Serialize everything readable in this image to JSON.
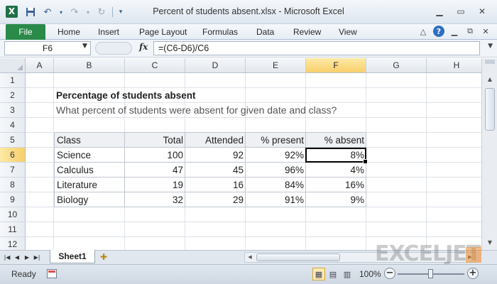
{
  "window": {
    "title": "Percent of students absent.xlsx  -  Microsoft Excel"
  },
  "quick_access": {
    "icons": [
      "excel-logo",
      "save-icon",
      "undo-icon",
      "redo-icon",
      "customize-icon"
    ]
  },
  "ribbon": {
    "file_label": "File",
    "tabs": [
      "Home",
      "Insert",
      "Page Layout",
      "Formulas",
      "Data",
      "Review",
      "View"
    ]
  },
  "formula_bar": {
    "name_box": "F6",
    "fx_label": "fx",
    "formula": "=(C6-D6)/C6"
  },
  "grid": {
    "columns": [
      "A",
      "B",
      "C",
      "D",
      "E",
      "F",
      "G",
      "H"
    ],
    "active_column": "F",
    "rows": [
      "1",
      "2",
      "3",
      "4",
      "5",
      "6",
      "7",
      "8",
      "9",
      "10",
      "11",
      "12"
    ],
    "active_row": "6"
  },
  "sheet": {
    "title": "Percentage of students absent",
    "subtitle": "What percent of students were absent for given date and class?",
    "table": {
      "headers": [
        "Class",
        "Total",
        "Attended",
        "% present",
        "% absent"
      ],
      "rows": [
        [
          "Science",
          "100",
          "92",
          "92%",
          "8%"
        ],
        [
          "Calculus",
          "47",
          "45",
          "96%",
          "4%"
        ],
        [
          "Literature",
          "19",
          "16",
          "84%",
          "16%"
        ],
        [
          "Biology",
          "32",
          "29",
          "91%",
          "9%"
        ]
      ]
    },
    "selected_cell": "F6"
  },
  "sheet_tabs": {
    "active": "Sheet1"
  },
  "watermark": {
    "text": "EXCELJET"
  },
  "status_bar": {
    "status": "Ready",
    "zoom": "100%"
  },
  "colors": {
    "file_tab": "#2a8a4a",
    "selection_header": "#f8cf6a",
    "excel_green": "#1e7145"
  }
}
